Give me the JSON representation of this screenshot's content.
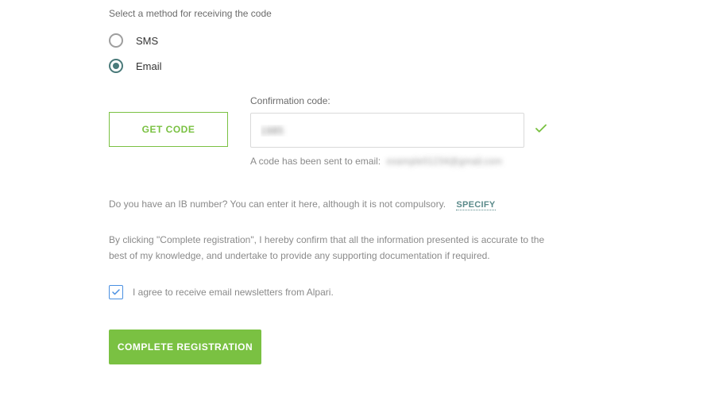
{
  "method": {
    "label": "Select a method for receiving the code",
    "options": {
      "sms": "SMS",
      "email": "Email"
    },
    "selected": "email"
  },
  "getCode": {
    "label": "GET CODE"
  },
  "confirmation": {
    "label": "Confirmation code:",
    "value": "1985",
    "sent_prefix": "A code has been sent to email:",
    "sent_email": "example01234@gmail.com"
  },
  "ib": {
    "text": "Do you have an IB number? You can enter it here, although it is not compulsory.",
    "link": "SPECIFY"
  },
  "disclaimer": "By clicking \"Complete registration\", I hereby confirm that all the information presented is accurate to the best of my knowledge, and undertake to provide any supporting documentation if required.",
  "newsletter": {
    "label": "I agree to receive email newsletters from Alpari.",
    "checked": true
  },
  "submit": {
    "label": "COMPLETE REGISTRATION"
  }
}
